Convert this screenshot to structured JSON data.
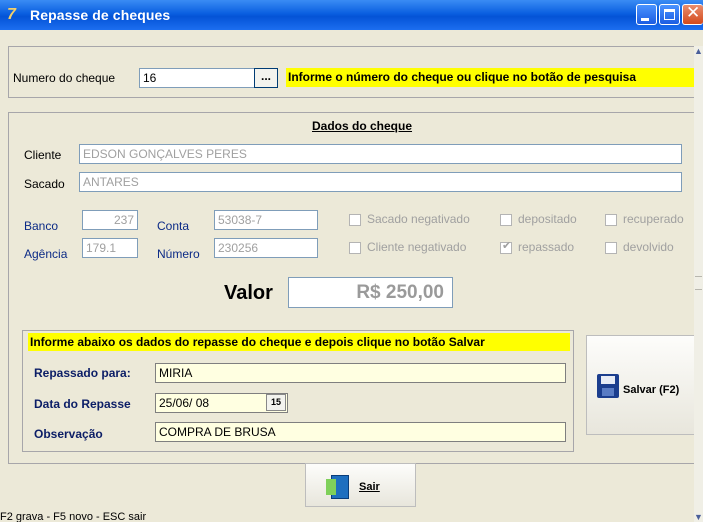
{
  "window": {
    "title": "Repasse de cheques",
    "app_icon": "7"
  },
  "cheque_search": {
    "label": "Numero do cheque",
    "value": "16",
    "lookup_button": "...",
    "hint": "Informe o número do cheque ou clique no botão de pesquisa"
  },
  "dados": {
    "title": "Dados do cheque",
    "cliente_label": "Cliente",
    "cliente_value": "EDSON GONÇALVES PERES",
    "sacado_label": "Sacado",
    "sacado_value": "ANTARES",
    "banco_label": "Banco",
    "banco_value": "237",
    "agencia_label": "Agência",
    "agencia_value": "179.1",
    "conta_label": "Conta",
    "conta_value": "53038-7",
    "numero_label": "Número",
    "numero_value": "230256",
    "flags": [
      {
        "label": "Sacado negativado",
        "checked": false
      },
      {
        "label": "depositado",
        "checked": false
      },
      {
        "label": "recuperado",
        "checked": false
      },
      {
        "label": "Cliente negativado",
        "checked": false
      },
      {
        "label": "repassado",
        "checked": true
      },
      {
        "label": "devolvido",
        "checked": false
      }
    ],
    "valor_label": "Valor",
    "valor_value": "R$ 250,00"
  },
  "repasse": {
    "hint": "Informe abaixo os dados do repasse do cheque e depois clique no botão Salvar",
    "repassado_label": "Repassado para:",
    "repassado_value": "MIRIA",
    "data_label": "Data do Repasse",
    "data_value": "25/06/ 08",
    "calendar_icon": "15",
    "obs_label": "Observação",
    "obs_value": "COMPRA DE BRUSA"
  },
  "buttons": {
    "salvar": "Salvar (F2)",
    "sair": "Sair"
  },
  "status": {
    "text": "F2 grava  -  F5 novo   -  ESC sair"
  },
  "colors": {
    "hint_yellow": "#ffff00",
    "readonly_field": "#ffffe1",
    "titlebar": "#0a5fe0"
  }
}
